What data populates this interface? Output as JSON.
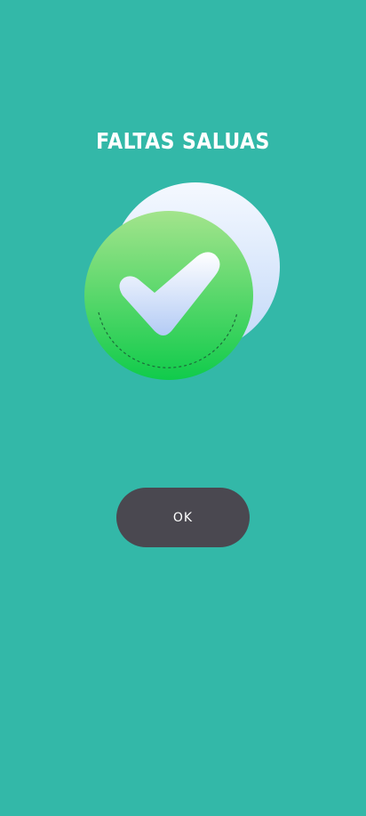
{
  "dialog": {
    "title": "FALTAS SALUAS",
    "icon": "check-badge-icon",
    "ok_label": "OK"
  },
  "colors": {
    "background": "#33b8a8",
    "button": "#4a4850",
    "badge_green_top": "#9fe28a",
    "badge_green_bottom": "#12cc4c",
    "back_circle_top": "#f4f8ff",
    "back_circle_bottom": "#c6dcfa"
  }
}
